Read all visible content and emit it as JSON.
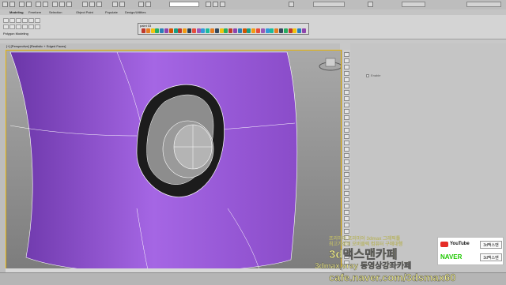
{
  "toolbar": {
    "workspace_field": "",
    "object_field": "",
    "user_label": "",
    "workspace_right": ""
  },
  "ribbon": {
    "tabs": [
      "Modeling",
      "Freeform",
      "Selection",
      "Object Paint",
      "Populate",
      "Design/Utilities"
    ],
    "active_tab": "Modeling",
    "panel_label": "Polygon Modeling"
  },
  "float_toolbar": {
    "title": "paint 03",
    "icon_colors": [
      "#c0392b",
      "#e67e22",
      "#f1c40f",
      "#27ae60",
      "#2980b9",
      "#8e44ad",
      "#d35400",
      "#16a085",
      "#c0392b",
      "#f39c12",
      "#2c3e50",
      "#e74c3c",
      "#9b59b6",
      "#3498db",
      "#1abc9c",
      "#e67e22",
      "#34495e",
      "#f1c40f",
      "#27ae60",
      "#c0392b",
      "#8e44ad",
      "#2980b9",
      "#d35400",
      "#16a085",
      "#f39c12",
      "#e74c3c",
      "#9b59b6",
      "#3498db",
      "#1abc9c",
      "#e67e22",
      "#34495e",
      "#27ae60",
      "#c0392b",
      "#f1c40f",
      "#2980b9",
      "#8e44ad"
    ]
  },
  "viewport": {
    "label": "[+] [Perspective] [Realistic + Edged Faces]",
    "object_color": "#9b5ad8",
    "highlight_color": "#e8b400"
  },
  "command_panel": {
    "checkbox_label": "Enable"
  },
  "watermark": {
    "line1": "프리미어 프리미어 3dmax 그래픽툴",
    "line2": "최고가성비 오버클럭 컴퓨터 구매대행",
    "title": "3d맥스맨카페",
    "subtitle": "3dmax,vray 동영상강좌카페",
    "url": "cafe.naver.com/3dsmax60"
  },
  "sponsor": {
    "youtube_label": "YouTube",
    "youtube_name": "3d맥스맨",
    "naver_label": "NAVER",
    "naver_name": "3d맥스맨"
  }
}
